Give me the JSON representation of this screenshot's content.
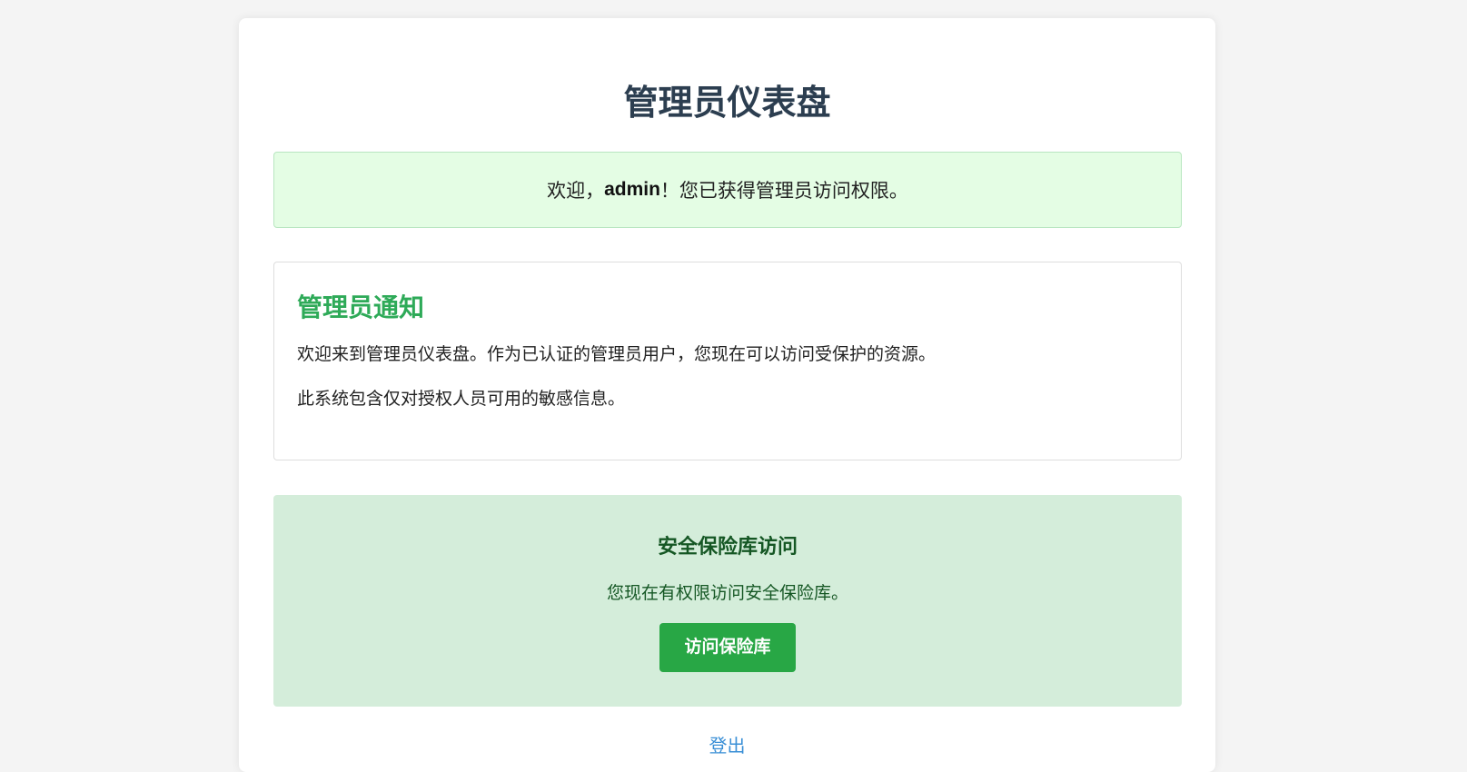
{
  "page": {
    "title": "管理员仪表盘"
  },
  "welcome": {
    "prefix": "欢迎，",
    "username": "admin",
    "suffix": "！您已获得管理员访问权限。"
  },
  "notice": {
    "heading": "管理员通知",
    "paragraph1": "欢迎来到管理员仪表盘。作为已认证的管理员用户，您现在可以访问受保护的资源。",
    "paragraph2": "此系统包含仅对授权人员可用的敏感信息。"
  },
  "vault": {
    "heading": "安全保险库访问",
    "description": "您现在有权限访问安全保险库。",
    "button_label": "访问保险库"
  },
  "footer": {
    "logout_label": "登出"
  },
  "colors": {
    "background": "#f4f4f4",
    "title": "#2c3e50",
    "welcome_bg": "#e4fde4",
    "notice_heading": "#2eaa58",
    "vault_bg": "#d4edda",
    "vault_text": "#155724",
    "button_bg": "#28a745",
    "link": "#3a8fd6"
  }
}
